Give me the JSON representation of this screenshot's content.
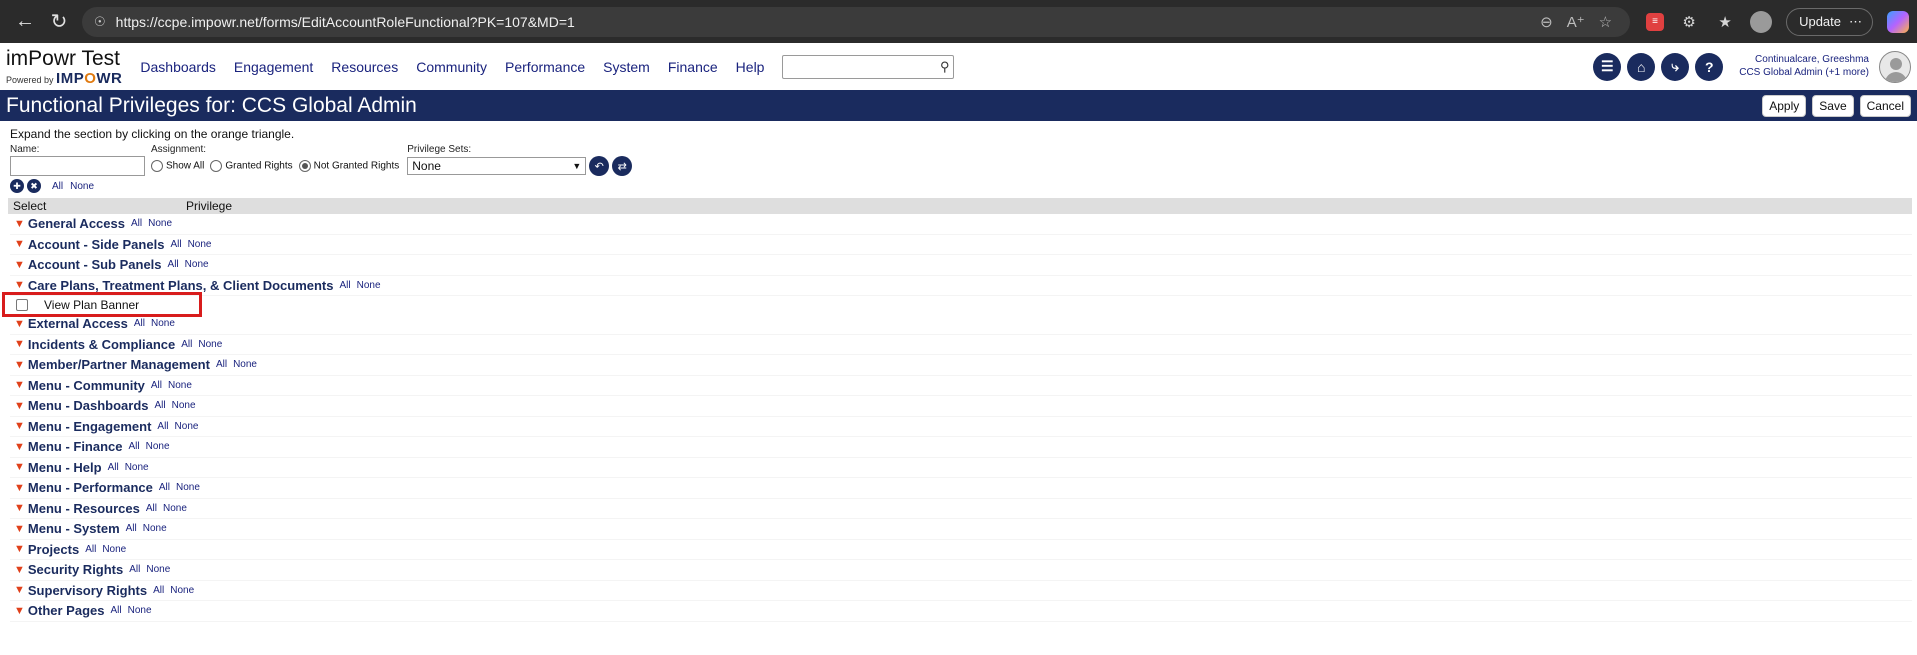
{
  "browser": {
    "url": "https://ccpe.impowr.net/forms/EditAccountRoleFunctional?PK=107&MD=1",
    "update_label": "Update"
  },
  "app": {
    "brand_title": "imPowr Test",
    "powered_by": "Powered by",
    "brand_logo_a": "IMP",
    "brand_logo_o": "O",
    "brand_logo_b": "WR",
    "nav": [
      "Dashboards",
      "Engagement",
      "Resources",
      "Community",
      "Performance",
      "System",
      "Finance",
      "Help"
    ],
    "search_placeholder": "",
    "user_name": "Continualcare, Greeshma",
    "user_role": "CCS Global Admin (+1 more)"
  },
  "page": {
    "title": "Functional Privileges for: CCS Global Admin",
    "apply": "Apply",
    "save": "Save",
    "cancel": "Cancel",
    "hint": "Expand the section by clicking on the orange triangle.",
    "name_label": "Name:",
    "assignment_label": "Assignment:",
    "assignment_options": [
      "Show All",
      "Granted Rights",
      "Not Granted Rights"
    ],
    "assignment_selected": "Not Granted Rights",
    "privsets_label": "Privilege Sets:",
    "privsets_value": "None",
    "all_label": "All",
    "none_label": "None",
    "col_select": "Select",
    "col_privilege": "Privilege"
  },
  "sections": [
    {
      "label": "General Access"
    },
    {
      "label": "Account - Side Panels"
    },
    {
      "label": "Account - Sub Panels"
    },
    {
      "label": "Care Plans, Treatment Plans, & Client Documents",
      "expanded": true,
      "items": [
        "View Plan Banner"
      ]
    },
    {
      "label": "External Access"
    },
    {
      "label": "Incidents & Compliance"
    },
    {
      "label": "Member/Partner Management"
    },
    {
      "label": "Menu - Community"
    },
    {
      "label": "Menu - Dashboards"
    },
    {
      "label": "Menu - Engagement"
    },
    {
      "label": "Menu - Finance"
    },
    {
      "label": "Menu - Help"
    },
    {
      "label": "Menu - Performance"
    },
    {
      "label": "Menu - Resources"
    },
    {
      "label": "Menu - System"
    },
    {
      "label": "Projects"
    },
    {
      "label": "Security Rights"
    },
    {
      "label": "Supervisory Rights"
    },
    {
      "label": "Other Pages"
    }
  ],
  "colors": {
    "navy": "#1a2b5e",
    "link": "#1a237e",
    "triangle": "#e0401a",
    "highlight": "#d81c1c"
  }
}
